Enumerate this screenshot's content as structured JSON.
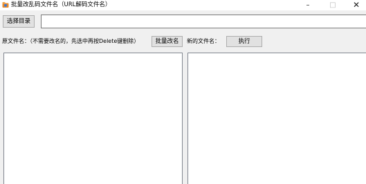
{
  "window": {
    "title": "批量改乱码文件名（URL解码文件名）",
    "controls": {
      "minimize": "–",
      "maximize": "□",
      "close": "✕"
    }
  },
  "toolbar": {
    "select_dir_label": "选择目录",
    "dir_path_value": ""
  },
  "original_section": {
    "label": "原文件名：（不需要改名的，先选中再按Delete键删除）",
    "batch_rename_label": "批量改名",
    "files": []
  },
  "new_section": {
    "label": "新的文件名：",
    "execute_label": "执行",
    "files": []
  },
  "colors": {
    "window_bg": "#f0f0f0",
    "titlebar_bg": "#ffffff",
    "button_bg": "#e1e1e1",
    "icon_orange": "#e8892b",
    "icon_blue": "#3a7bd5"
  },
  "icons": {
    "app": "app-folder-icon"
  }
}
